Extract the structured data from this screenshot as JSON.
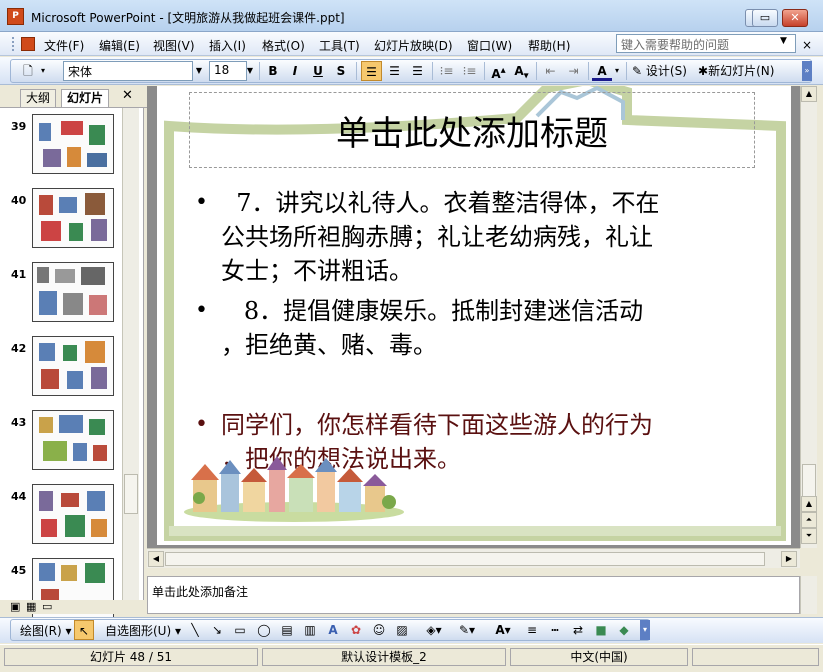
{
  "window": {
    "title": "Microsoft PowerPoint - [文明旅游从我做起班会课件.ppt]",
    "app_icon": "powerpoint-icon",
    "controls": [
      "minimize-icon",
      "maximize-icon",
      "close-icon"
    ]
  },
  "menubar": {
    "items": [
      "文件(F)",
      "编辑(E)",
      "视图(V)",
      "插入(I)",
      "格式(O)",
      "工具(T)",
      "幻灯片放映(D)",
      "窗口(W)",
      "帮助(H)"
    ],
    "help_placeholder": "键入需要帮助的问题"
  },
  "toolbar": {
    "font_name": "宋体",
    "font_size": "18",
    "bold": "B",
    "italic": "I",
    "underline": "U",
    "shadow": "S",
    "design_label": "设计(S)",
    "new_slide_label": "新幻灯片(N)"
  },
  "panel": {
    "tabs": [
      "大纲",
      "幻灯片"
    ],
    "close_icon": "close-icon",
    "thumbnails": [
      {
        "number": "39"
      },
      {
        "number": "40"
      },
      {
        "number": "41"
      },
      {
        "number": "42"
      },
      {
        "number": "43"
      },
      {
        "number": "44"
      },
      {
        "number": "45"
      }
    ]
  },
  "slide": {
    "title_placeholder": "单击此处添加标题",
    "bullets": [
      {
        "lines": [
          "  7．讲究以礼待人。衣着整洁得体，不在",
          "公共场所袒胸赤膊；礼让老幼病残，礼让",
          "女士；不讲粗话。"
        ]
      },
      {
        "lines": [
          "   8．提倡健康娱乐。抵制封建迷信活动",
          "，拒绝黄、赌、毒。"
        ]
      },
      {
        "lines": [
          "同学们，你怎样看待下面这些游人的行为",
          "，把你的想法说出来。"
        ]
      }
    ],
    "bullet_char": "•",
    "accent_frame_color": "#c5d3a3",
    "red_text_color": "#5a1010"
  },
  "notes": {
    "placeholder": "单击此处添加备注"
  },
  "drawing_toolbar": {
    "draw_label": "绘图(R)",
    "autoshapes_label": "自选图形(U)"
  },
  "status": {
    "slide": "幻灯片 48 / 51",
    "template": "默认设计模板_2",
    "language": "中文(中国)"
  }
}
